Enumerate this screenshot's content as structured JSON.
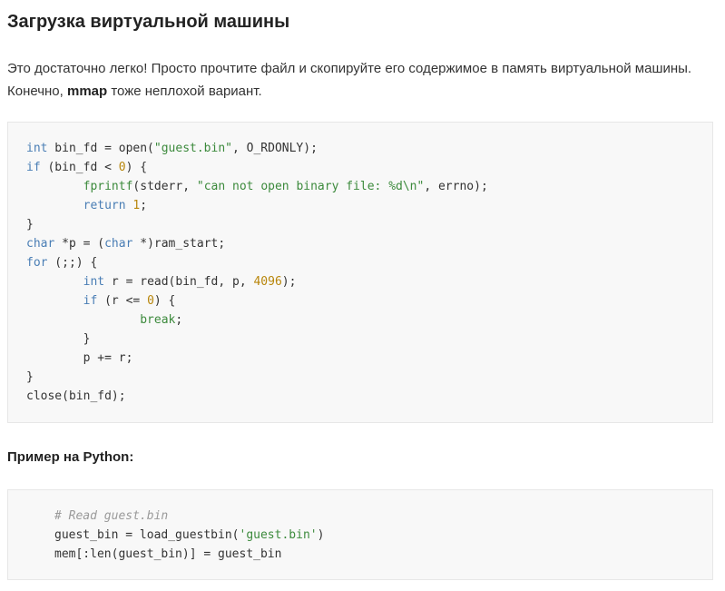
{
  "article": {
    "title": "Загрузка виртуальной машины",
    "paragraph": {
      "before": "Это достаточно легко! Просто прочтите файл и скопируйте его содержимое в память виртуальной машины. Конечно, ",
      "bold": "mmap",
      "after": " тоже неплохой вариант."
    },
    "python_heading": "Пример на Python:"
  },
  "code_c": [
    [
      {
        "t": "int",
        "c": "kw"
      },
      {
        "t": " bin_fd = open("
      },
      {
        "t": "\"guest.bin\"",
        "c": "str"
      },
      {
        "t": ", O_RDONLY);"
      }
    ],
    [
      {
        "t": "if",
        "c": "kw"
      },
      {
        "t": " (bin_fd < "
      },
      {
        "t": "0",
        "c": "num"
      },
      {
        "t": ") {"
      }
    ],
    [
      {
        "t": "        "
      },
      {
        "t": "fprintf",
        "c": "fn"
      },
      {
        "t": "(stderr, "
      },
      {
        "t": "\"can not open binary file: %d\\n\"",
        "c": "str"
      },
      {
        "t": ", errno);"
      }
    ],
    [
      {
        "t": "        "
      },
      {
        "t": "return",
        "c": "kw"
      },
      {
        "t": " "
      },
      {
        "t": "1",
        "c": "num"
      },
      {
        "t": ";"
      }
    ],
    [
      {
        "t": "}"
      }
    ],
    [
      {
        "t": "char",
        "c": "kw"
      },
      {
        "t": " *p = ("
      },
      {
        "t": "char",
        "c": "kw"
      },
      {
        "t": " *)ram_start;"
      }
    ],
    [
      {
        "t": "for",
        "c": "kw"
      },
      {
        "t": " (;;) {"
      }
    ],
    [
      {
        "t": "        "
      },
      {
        "t": "int",
        "c": "kw"
      },
      {
        "t": " r = read(bin_fd, p, "
      },
      {
        "t": "4096",
        "c": "num"
      },
      {
        "t": ");"
      }
    ],
    [
      {
        "t": "        "
      },
      {
        "t": "if",
        "c": "kw"
      },
      {
        "t": " (r <= "
      },
      {
        "t": "0",
        "c": "num"
      },
      {
        "t": ") {"
      }
    ],
    [
      {
        "t": "                "
      },
      {
        "t": "break",
        "c": "fn"
      },
      {
        "t": ";"
      }
    ],
    [
      {
        "t": "        }"
      }
    ],
    [
      {
        "t": "        p += r;"
      }
    ],
    [
      {
        "t": "}"
      }
    ],
    [
      {
        "t": "close(bin_fd);"
      }
    ]
  ],
  "code_py": [
    [
      {
        "t": "# Read guest.bin",
        "c": "cmt"
      }
    ],
    [
      {
        "t": "guest_bin = load_guestbin("
      },
      {
        "t": "'guest.bin'",
        "c": "str"
      },
      {
        "t": ")"
      }
    ],
    [
      {
        "t": "mem[:len(guest_bin)] = guest_bin"
      }
    ]
  ],
  "colors": {
    "keyword": "#4a7eb5",
    "string": "#3c8a3c",
    "number": "#b8860b",
    "comment": "#9a9a9a",
    "code_background": "#f8f8f8"
  }
}
